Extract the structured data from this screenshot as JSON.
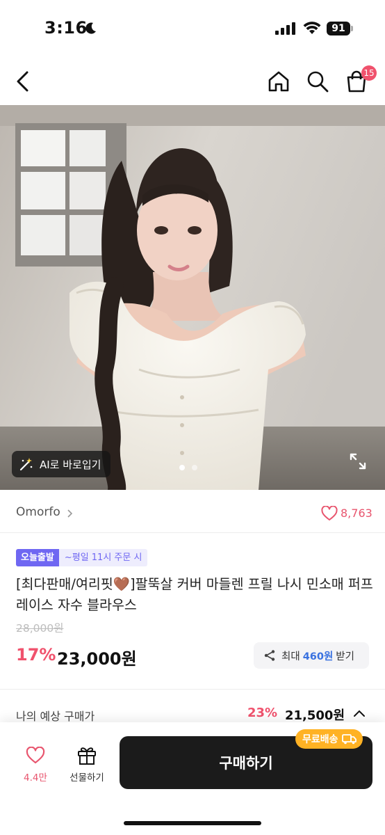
{
  "status_bar": {
    "time": "3:16",
    "battery": "91"
  },
  "nav": {
    "cart_count": "15"
  },
  "hero": {
    "ai_button_label": "AI로 바로입기",
    "slide_count": 2,
    "active_slide": 1
  },
  "brand": {
    "name": "Omorfo",
    "likes": "8,763"
  },
  "product": {
    "badge_primary": "오늘출발",
    "badge_secondary": "~평일 11시 주문 시",
    "title": "[최다판매/여리핏🤎]팔뚝살 커버 마들렌 프릴 나시 민소매 퍼프 레이스 자수 블라우스",
    "original_price": "28,000원",
    "discount_rate": "17%",
    "price": "23,000원",
    "points_prefix": "최대",
    "points_amount": "460원",
    "points_suffix": "받기"
  },
  "estimate": {
    "label": "나의 예상 구매가",
    "discount_rate": "23%",
    "price": "21,500원"
  },
  "bottom_bar": {
    "like_count": "4.4만",
    "gift_label": "선물하기",
    "buy_label": "구매하기",
    "free_shipping": "무료배송"
  },
  "colors": {
    "accent_pink": "#f0526d",
    "badge_purple": "#6f67f2",
    "points_blue": "#3a72e0",
    "ship_orange": "#ffb224"
  }
}
